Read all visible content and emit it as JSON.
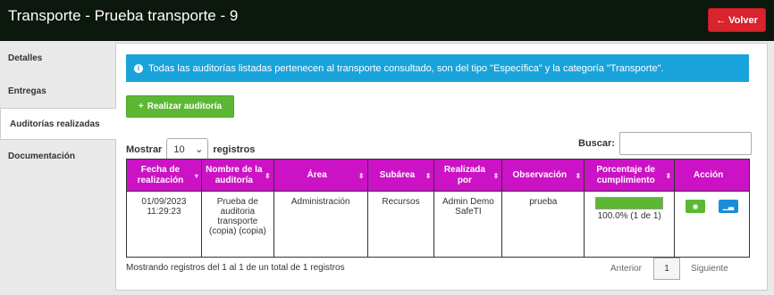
{
  "header": {
    "title": "Transporte - Prueba transporte - 9",
    "back_label": "Volver",
    "back_icon": "arrow-left-icon"
  },
  "sidebar": {
    "items": [
      {
        "label": "Detalles"
      },
      {
        "label": "Entregas"
      },
      {
        "label": "Auditorías realizadas"
      },
      {
        "label": "Documentación"
      }
    ]
  },
  "alert": {
    "text": "Todas las auditorías listadas pertenecen al transporte consultado, son del tipo \"Específica\" y la categoría \"Transporte\"."
  },
  "add_button": {
    "label": "Realizar auditoría",
    "icon_glyph": "+"
  },
  "table_controls": {
    "show_prefix": "Mostrar",
    "show_value": "10",
    "show_suffix": "registros",
    "search_label": "Buscar:"
  },
  "table": {
    "headers": [
      "Fecha de realización",
      "Nombre de la auditoría",
      "Área",
      "Subárea",
      "Realizada por",
      "Observación",
      "Porcentaje de cumplimiento",
      "Acción"
    ],
    "rows": [
      {
        "fecha": "01/09/2023 11:29:23",
        "nombre": "Prueba de auditoria transporte (copia) (copia)",
        "area": "Administración",
        "subarea": "Recursos",
        "realizada": "Admin Demo SafeTI",
        "observacion": "prueba",
        "porcentaje": "100.0% (1 de 1)",
        "progress": 1.0
      }
    ]
  },
  "footer": {
    "info": "Mostrando registros del 1 al 1 de un total de 1 registros",
    "prev": "Anterior",
    "page": "1",
    "next": "Siguiente"
  },
  "colors": {
    "header_bg": "#0c170d",
    "back_button": "#d9232d",
    "alert_bg": "#1aa3db",
    "add_button": "#5cb833",
    "table_header": "#cc12c5",
    "progress": "#5cb833",
    "chart_button": "#1a8ed6"
  }
}
